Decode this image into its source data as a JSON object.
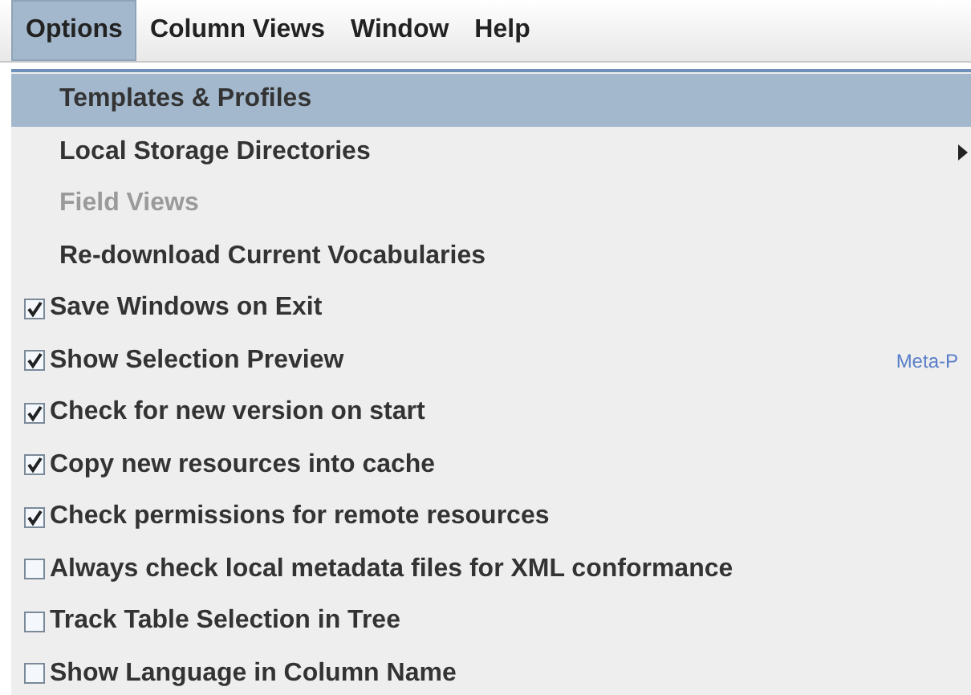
{
  "menubar": [
    {
      "label": "Options",
      "selected": true
    },
    {
      "label": "Column Views",
      "selected": false
    },
    {
      "label": "Window",
      "selected": false
    },
    {
      "label": "Help",
      "selected": false
    }
  ],
  "menu": [
    {
      "kind": "action",
      "label": "Templates & Profiles",
      "selected": true,
      "disabled": false,
      "submenu": false
    },
    {
      "kind": "action",
      "label": "Local Storage Directories",
      "selected": false,
      "disabled": false,
      "submenu": true
    },
    {
      "kind": "action",
      "label": "Field Views",
      "selected": false,
      "disabled": true,
      "submenu": false
    },
    {
      "kind": "action",
      "label": "Re-download Current Vocabularies",
      "selected": false,
      "disabled": false,
      "submenu": false
    },
    {
      "kind": "check",
      "label": "Save Windows on Exit",
      "checked": true,
      "selected": false
    },
    {
      "kind": "check",
      "label": "Show Selection Preview",
      "checked": true,
      "selected": false,
      "shortcut": "Meta-P"
    },
    {
      "kind": "check",
      "label": "Check for new version on start",
      "checked": true,
      "selected": false
    },
    {
      "kind": "check",
      "label": "Copy new resources into cache",
      "checked": true,
      "selected": false
    },
    {
      "kind": "check",
      "label": "Check permissions for remote resources",
      "checked": true,
      "selected": false
    },
    {
      "kind": "check",
      "label": "Always check local metadata files for XML conformance",
      "checked": false,
      "selected": false
    },
    {
      "kind": "check",
      "label": "Track Table Selection in Tree",
      "checked": false,
      "selected": false
    },
    {
      "kind": "check",
      "label": "Show Language in Column Name",
      "checked": false,
      "selected": false
    }
  ]
}
